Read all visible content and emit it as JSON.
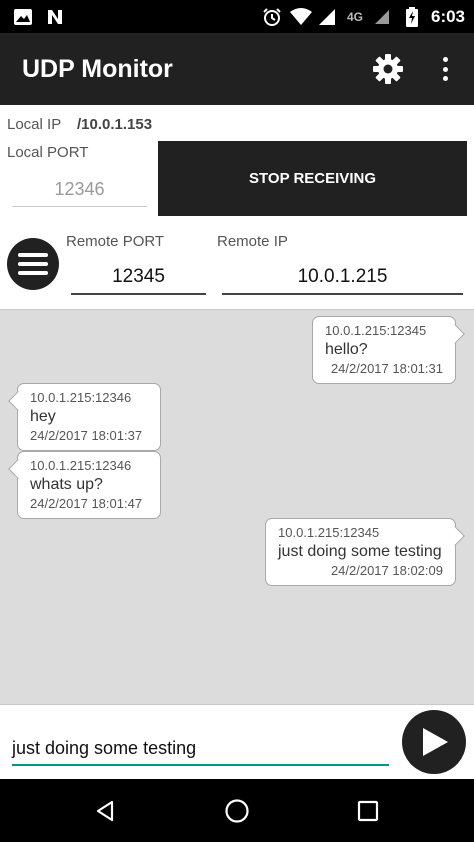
{
  "status_bar": {
    "time": "6:03",
    "network": "4G",
    "icons": [
      "image-icon",
      "n-app-icon",
      "alarm-icon",
      "wifi-icon",
      "cell-signal-icon",
      "battery-charging-icon"
    ]
  },
  "app_bar": {
    "title": "UDP Monitor",
    "settings_icon": "gear-icon",
    "overflow_icon": "more-vert-icon"
  },
  "config": {
    "local_ip_label": "Local IP",
    "local_ip_value": "/10.0.1.153",
    "local_port_label": "Local PORT",
    "local_port_value": "12346",
    "stop_button_label": "STOP RECEIVING",
    "remote_port_label": "Remote PORT",
    "remote_port_value": "12345",
    "remote_ip_label": "Remote IP",
    "remote_ip_value": "10.0.1.215"
  },
  "messages": [
    {
      "direction": "outgoing",
      "sender": "10.0.1.215:12345",
      "text": "hello?",
      "time": "24/2/2017 18:01:31"
    },
    {
      "direction": "incoming",
      "sender": "10.0.1.215:12346",
      "text": "hey",
      "time": "24/2/2017 18:01:37"
    },
    {
      "direction": "incoming",
      "sender": "10.0.1.215:12346",
      "text": "whats up?",
      "time": "24/2/2017 18:01:47"
    },
    {
      "direction": "outgoing",
      "sender": "10.0.1.215:12345",
      "text": "just doing some testing",
      "time": "24/2/2017 18:02:09"
    }
  ],
  "compose": {
    "value": "just doing some testing"
  },
  "colors": {
    "app_bar": "#212121",
    "message_area": "#dcdcdc",
    "input_underline_active": "#009688"
  }
}
